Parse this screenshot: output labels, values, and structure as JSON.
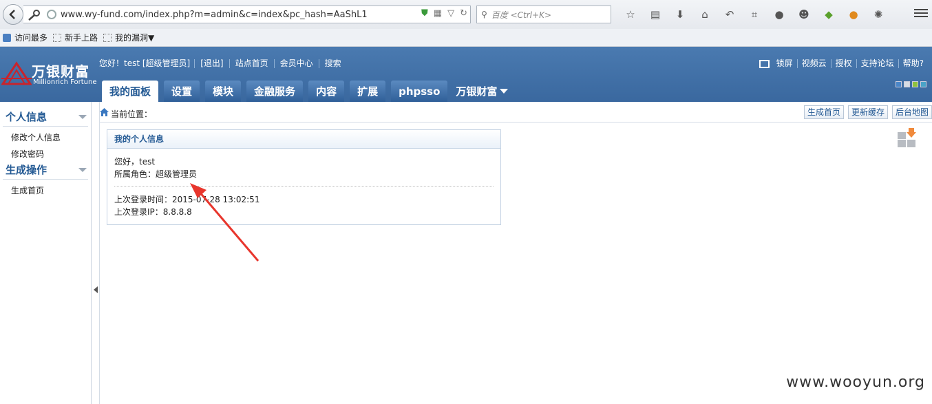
{
  "browser": {
    "url": "www.wy-fund.com/index.php?m=admin&c=index&pc_hash=AaShL1",
    "search_placeholder": "百度 <Ctrl+K>",
    "bookmarks": [
      "访问最多",
      "新手上路",
      "我的漏洞▼"
    ]
  },
  "header": {
    "logo_title": "万银财富",
    "logo_subtitle": "Millionrich Fortune",
    "greeting": "您好！test [超级管理员]",
    "top_links": [
      "[退出]",
      "站点首页",
      "会员中心",
      "搜索"
    ],
    "right_links": [
      "锁屏",
      "视频云",
      "授权",
      "支持论坛",
      "帮助?"
    ],
    "tabs": [
      "我的面板",
      "设置",
      "模块",
      "金融服务",
      "内容",
      "扩展",
      "phpsso",
      "万银财富"
    ],
    "active_tab": "我的面板"
  },
  "sidebar": {
    "section1": "个人信息",
    "section1_items": [
      "修改个人信息",
      "修改密码"
    ],
    "section2": "生成操作",
    "section2_items": [
      "生成首页"
    ]
  },
  "breadcrumb": {
    "label": "当前位置：",
    "buttons": [
      "生成首页",
      "更新缓存",
      "后台地图"
    ]
  },
  "panel": {
    "title": "我的个人信息",
    "hello": "您好，test",
    "role": "所属角色：超级管理员",
    "last_login_time": "上次登录时间：2015-07-28 13:02:51",
    "last_login_ip": "上次登录IP：8.8.8.8"
  },
  "watermark": "www.wooyun.org",
  "colors": {
    "header": "#3a689f",
    "accent": "#245a94",
    "annotation": "#e8362d"
  }
}
